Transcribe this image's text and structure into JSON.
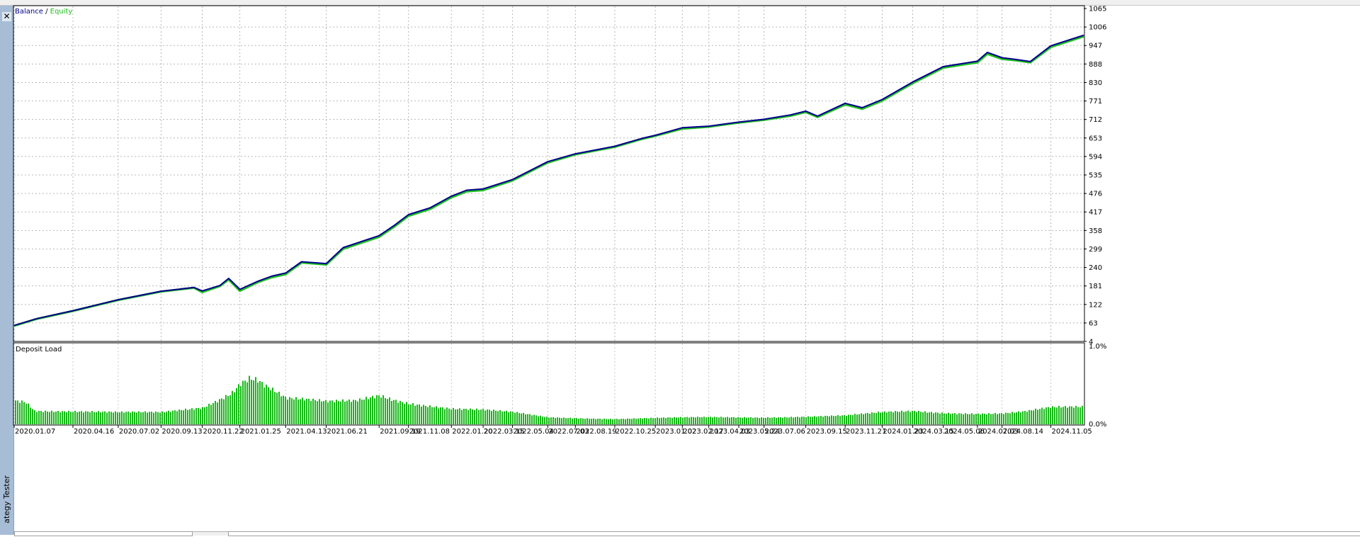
{
  "window": {
    "close_glyph": "✕",
    "panel_label": "ategy Tester"
  },
  "chart_data": [
    {
      "type": "line",
      "legend": [
        {
          "name": "Balance",
          "color": "#00008b"
        },
        {
          "name": "Equity",
          "color": "#1fbf1f"
        }
      ],
      "legend_separator": " / ",
      "ylim": [
        4,
        1065
      ],
      "yticks": [
        "1065",
        "1006",
        "947",
        "888",
        "830",
        "771",
        "712",
        "653",
        "594",
        "535",
        "476",
        "417",
        "358",
        "299",
        "240",
        "181",
        "122",
        "63",
        "4"
      ],
      "grid": true,
      "series": [
        {
          "name": "Balance",
          "x": [
            "2020.01.07",
            "2020.02.15",
            "2020.04.16",
            "2020.07.02",
            "2020.09.13",
            "2020.11.08",
            "2020.11.22",
            "2020.12.22",
            "2021.01.06",
            "2021.01.25",
            "2021.02.25",
            "2021.03.20",
            "2021.04.13",
            "2021.05.10",
            "2021.06.21",
            "2021.07.20",
            "2021.09.19",
            "2021.10.15",
            "2021.11.08",
            "2021.12.15",
            "2022.01.20",
            "2022.02.15",
            "2022.03.15",
            "2022.05.04",
            "2022.07.03",
            "2022.08.19",
            "2022.10.25",
            "2022.12.10",
            "2023.01.02",
            "2023.02.17",
            "2023.04.03",
            "2023.05.24",
            "2023.07.06",
            "2023.08.20",
            "2023.09.15",
            "2023.10.05",
            "2023.11.21",
            "2023.12.20",
            "2024.01.23",
            "2024.03.15",
            "2024.05.06",
            "2024.07.03",
            "2024.07.20",
            "2024.08.14",
            "2024.09.05",
            "2024.10.01",
            "2024.11.05",
            "2024.12.31"
          ],
          "values": [
            55,
            77,
            102,
            137,
            164,
            176,
            165,
            182,
            205,
            170,
            196,
            212,
            222,
            258,
            252,
            303,
            341,
            374,
            408,
            430,
            467,
            486,
            490,
            520,
            577,
            602,
            626,
            651,
            661,
            685,
            690,
            703,
            712,
            726,
            738,
            722,
            763,
            749,
            775,
            831,
            880,
            897,
            925,
            908,
            903,
            896,
            946,
            980
          ]
        },
        {
          "name": "Equity",
          "x": [
            "2020.01.07",
            "2020.02.15",
            "2020.04.16",
            "2020.07.02",
            "2020.09.13",
            "2020.11.08",
            "2020.11.22",
            "2020.12.22",
            "2021.01.06",
            "2021.01.25",
            "2021.02.25",
            "2021.03.20",
            "2021.04.13",
            "2021.05.10",
            "2021.06.21",
            "2021.07.20",
            "2021.09.19",
            "2021.10.15",
            "2021.11.08",
            "2021.12.15",
            "2022.01.20",
            "2022.02.15",
            "2022.03.15",
            "2022.05.04",
            "2022.07.03",
            "2022.08.19",
            "2022.10.25",
            "2022.12.10",
            "2023.01.02",
            "2023.02.17",
            "2023.04.03",
            "2023.05.24",
            "2023.07.06",
            "2023.08.20",
            "2023.09.15",
            "2023.10.05",
            "2023.11.21",
            "2023.12.20",
            "2024.01.23",
            "2024.03.15",
            "2024.05.06",
            "2024.07.03",
            "2024.07.20",
            "2024.08.14",
            "2024.09.05",
            "2024.10.01",
            "2024.11.05",
            "2024.12.31"
          ],
          "values": [
            54,
            76,
            101,
            136,
            163,
            175,
            161,
            180,
            201,
            165,
            193,
            208,
            218,
            255,
            249,
            299,
            337,
            370,
            404,
            426,
            463,
            482,
            486,
            517,
            574,
            600,
            624,
            649,
            659,
            682,
            688,
            701,
            710,
            723,
            735,
            719,
            759,
            745,
            771,
            827,
            876,
            893,
            920,
            904,
            900,
            893,
            942,
            976
          ]
        }
      ]
    },
    {
      "type": "bar",
      "title": "Deposit Load",
      "ylim": [
        0,
        1.0
      ],
      "yticks": [
        "1.0%",
        "0.0%"
      ],
      "grid": true,
      "color": "#16b816",
      "x": [
        "2020.01.07",
        "2020.01.25",
        "2020.02.10",
        "2020.04.16",
        "2020.07.02",
        "2020.09.13",
        "2020.11.22",
        "2020.12.20",
        "2021.01.10",
        "2021.01.25",
        "2021.02.10",
        "2021.02.25",
        "2021.03.05",
        "2021.03.20",
        "2021.04.13",
        "2021.06.21",
        "2021.08.10",
        "2021.09.19",
        "2021.10.10",
        "2021.11.08",
        "2022.01.20",
        "2022.03.15",
        "2022.05.04",
        "2022.07.03",
        "2022.10.25",
        "2023.01.02",
        "2023.04.03",
        "2023.07.06",
        "2023.09.15",
        "2023.11.21",
        "2024.01.23",
        "2024.03.15",
        "2024.05.06",
        "2024.07.03",
        "2024.08.14",
        "2024.09.20",
        "2024.11.05",
        "2024.12.31"
      ],
      "values": [
        0.31,
        0.3,
        0.18,
        0.17,
        0.15,
        0.15,
        0.22,
        0.33,
        0.42,
        0.55,
        0.62,
        0.58,
        0.52,
        0.45,
        0.33,
        0.28,
        0.3,
        0.38,
        0.33,
        0.28,
        0.2,
        0.18,
        0.15,
        0.09,
        0.07,
        0.08,
        0.09,
        0.09,
        0.1,
        0.11,
        0.15,
        0.17,
        0.15,
        0.14,
        0.14,
        0.16,
        0.21,
        0.22
      ]
    }
  ],
  "x_axis_labels": [
    "2020.01.07",
    "2020.04.16",
    "2020.07.02",
    "2020.09.13",
    "2020.11.22",
    "2021.01.25",
    "2021.04.13",
    "2021.06.21",
    "2021.09.19",
    "2021.11.08",
    "2022.01.20",
    "2022.03.15",
    "2022.05.04",
    "2022.07.03",
    "2022.08.19",
    "2022.10.25",
    "2023.01.02",
    "2023.02.17",
    "2023.04.03",
    "2023.05.24",
    "2023.07.06",
    "2023.09.15",
    "2023.11.21",
    "2024.01.23",
    "2024.03.15",
    "2024.05.06",
    "2024.07.03",
    "2024.08.14",
    "2024.11.05"
  ]
}
